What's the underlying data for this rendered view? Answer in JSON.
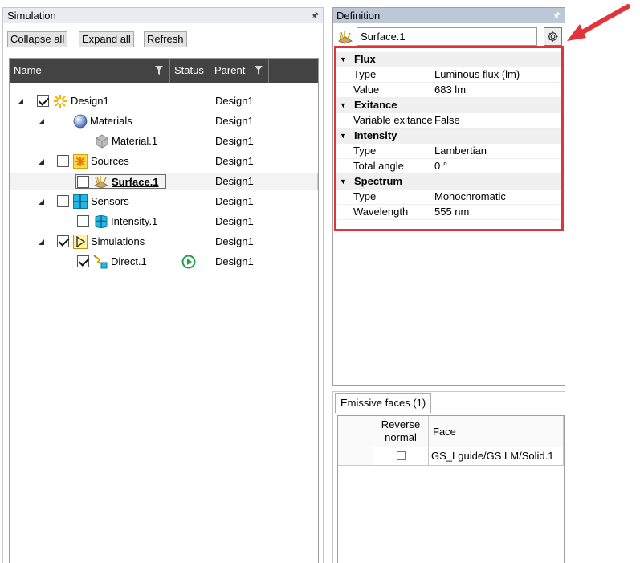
{
  "simulation_panel": {
    "title": "Simulation",
    "toolbar": {
      "collapse_label": "Collapse all",
      "expand_label": "Expand all",
      "refresh_label": "Refresh"
    },
    "columns": {
      "name": "Name",
      "status": "Status",
      "parent": "Parent"
    },
    "tree": [
      {
        "label": "Design1",
        "parent": "Design1",
        "checked": true,
        "icon": "design-icon"
      },
      {
        "label": "Materials",
        "parent": "Design1",
        "icon": "materials-icon"
      },
      {
        "label": "Material.1",
        "parent": "Design1",
        "icon": "material-cube-icon"
      },
      {
        "label": "Sources",
        "parent": "Design1",
        "checked": false,
        "icon": "sources-icon"
      },
      {
        "label": "Surface.1",
        "parent": "Design1",
        "checked": false,
        "selected": true,
        "icon": "surface-source-icon"
      },
      {
        "label": "Sensors",
        "parent": "Design1",
        "checked": false,
        "icon": "sensors-icon"
      },
      {
        "label": "Intensity.1",
        "parent": "Design1",
        "checked": false,
        "icon": "intensity-sensor-icon"
      },
      {
        "label": "Simulations",
        "parent": "Design1",
        "checked": true,
        "icon": "simulations-icon"
      },
      {
        "label": "Direct.1",
        "parent": "Design1",
        "checked": true,
        "icon": "direct-simulation-icon",
        "status_icon": "run-status-icon"
      }
    ]
  },
  "definition_panel": {
    "title": "Definition",
    "selected_item": "Surface.1",
    "categories": [
      {
        "name": "Flux",
        "props": [
          {
            "key": "Type",
            "value": "Luminous flux (lm)"
          },
          {
            "key": "Value",
            "value": "683 lm"
          }
        ]
      },
      {
        "name": "Exitance",
        "props": [
          {
            "key": "Variable exitance",
            "value": "False"
          }
        ]
      },
      {
        "name": "Intensity",
        "props": [
          {
            "key": "Type",
            "value": "Lambertian"
          },
          {
            "key": "Total angle",
            "value": "0 °"
          }
        ]
      },
      {
        "name": "Spectrum",
        "props": [
          {
            "key": "Type",
            "value": "Monochromatic"
          },
          {
            "key": "Wavelength",
            "value": "555 nm"
          }
        ]
      }
    ]
  },
  "emissive_panel": {
    "tab_label": "Emissive faces (1)",
    "col_reverse_1": "Reverse",
    "col_reverse_2": "normal",
    "col_face": "Face",
    "rows": [
      {
        "reverse": false,
        "face": "GS_Lguide/GS LM/Solid.1"
      }
    ]
  },
  "colors": {
    "highlight_box": "#e0343a",
    "header_dark": "#434343",
    "definition_title": "#bcc7d8"
  }
}
